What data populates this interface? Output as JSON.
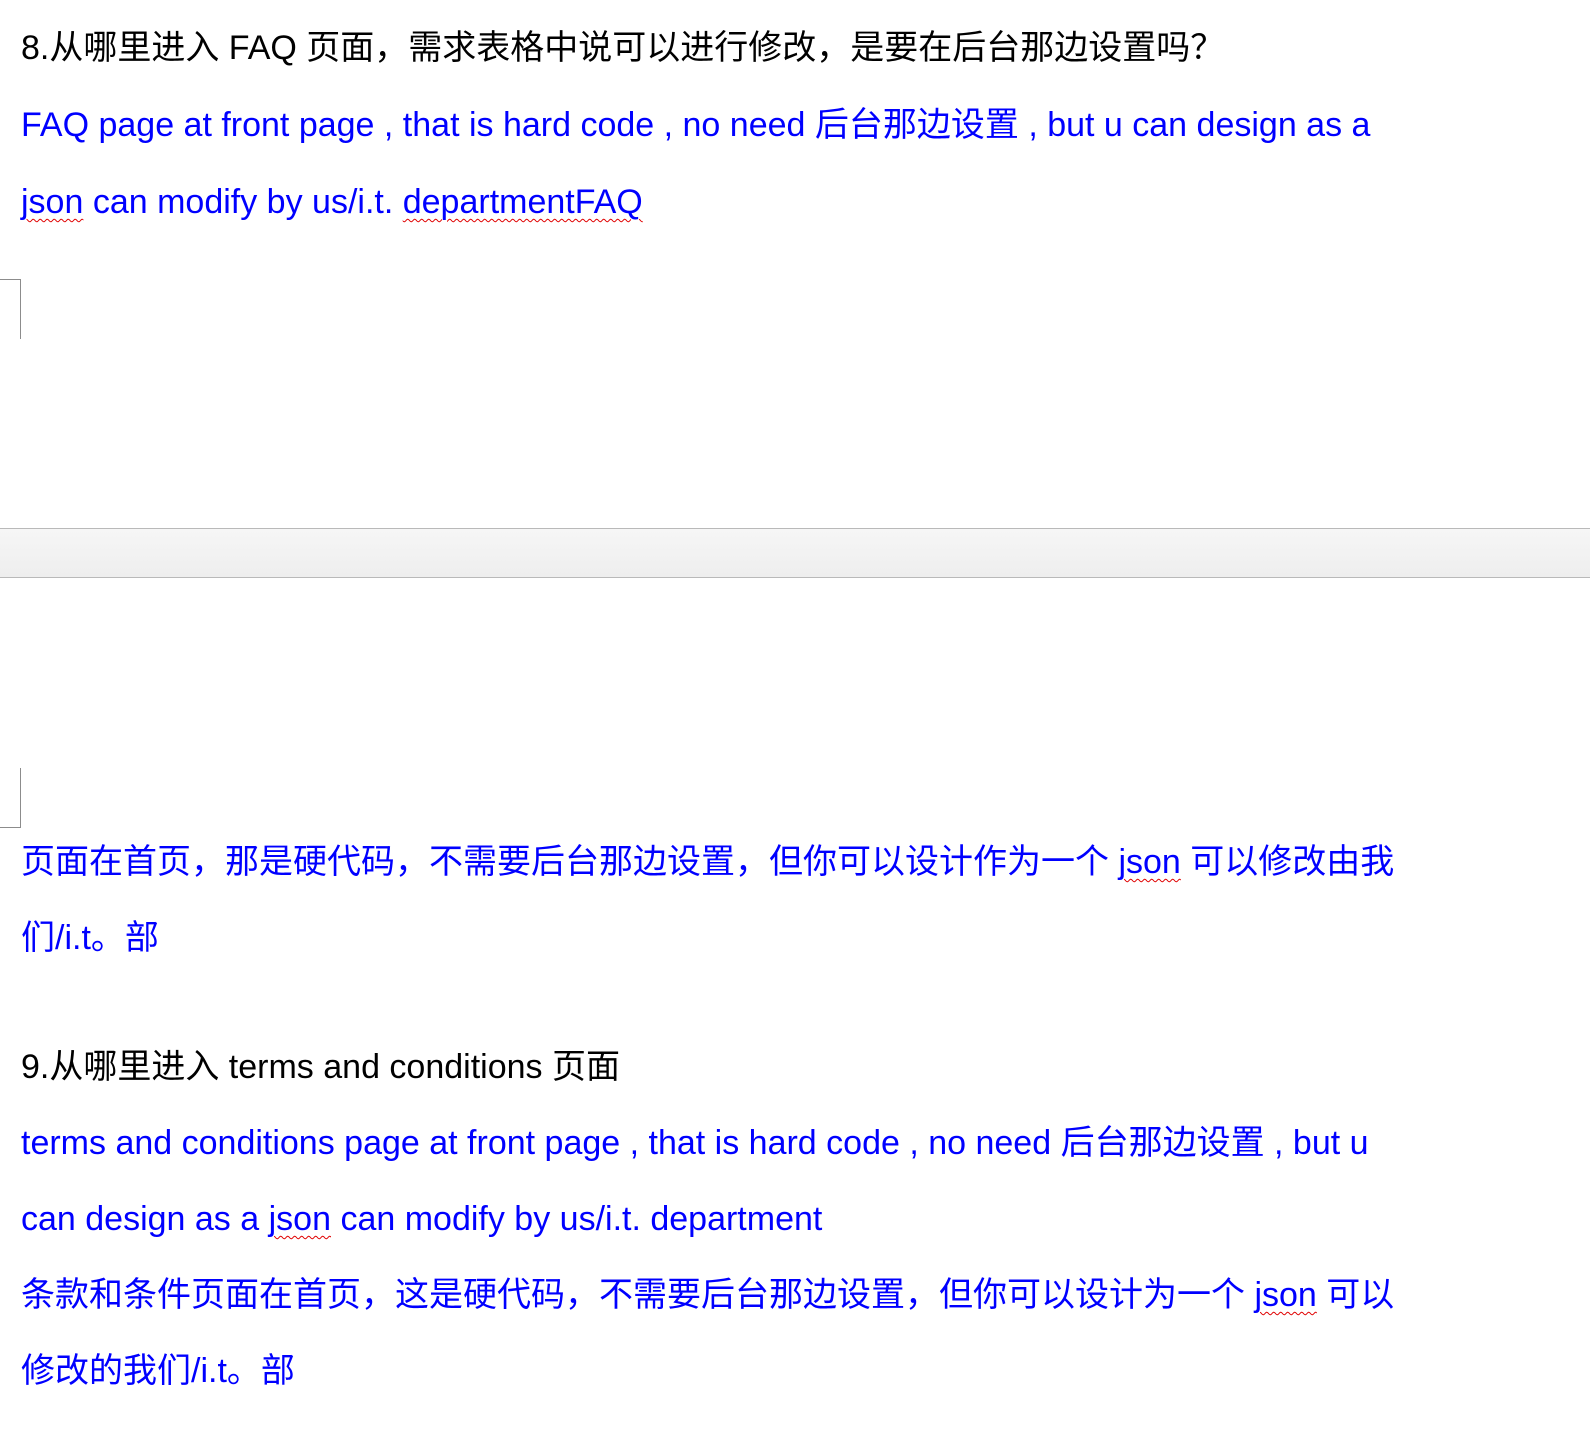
{
  "q8": {
    "question": "8.从哪里进入 FAQ 页面，需求表格中说可以进行修改，是要在后台那边设置吗？",
    "en_line1": "FAQ page at front page , that is hard code , no need 后台那边设置 , but u can design as a",
    "en_line2_a": "json",
    "en_line2_b": " can modify by us/i.t. ",
    "en_line2_c": "departmentFAQ",
    "zh_line1_a": "页面在首页，那是硬代码，不需要后台那边设置，但你可以设计作为一个 ",
    "zh_line1_b": "json",
    "zh_line1_c": " 可以修改由我",
    "zh_line2": "们/i.t。部"
  },
  "q9": {
    "question": "9.从哪里进入 terms and conditions 页面",
    "en_line1": "terms and conditions page at front page , that is hard code , no need 后台那边设置 , but u",
    "en_line2_a": "can design as a ",
    "en_line2_b": "json",
    "en_line2_c": " can modify by us/i.t. department",
    "zh_line1_a": "条款和条件页面在首页，这是硬代码，不需要后台那边设置，但你可以设计为一个 ",
    "zh_line1_b": "json",
    "zh_line1_c": " 可以",
    "zh_line2": "修改的我们/i.t。部"
  }
}
